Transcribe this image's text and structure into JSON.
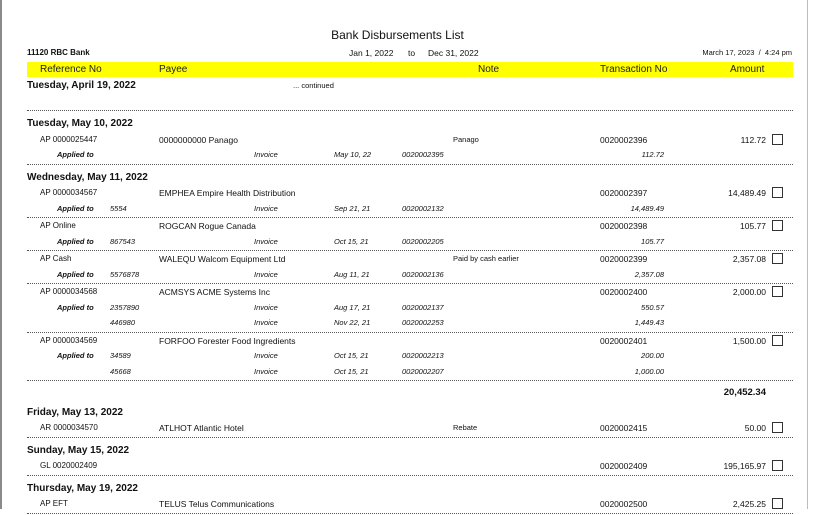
{
  "report": {
    "title": "Bank Disbursements List",
    "bank": "11120 RBC Bank",
    "date_from": "Jan 1, 2022",
    "to_label": "to",
    "date_to": "Dec 31, 2022",
    "printed": "March 17, 2023  /  4:24 pm"
  },
  "columns": {
    "reference": "Reference No",
    "payee": "Payee",
    "note": "Note",
    "transaction": "Transaction No",
    "amount": "Amount"
  },
  "continued_day": {
    "date": "Tuesday, April 19, 2022",
    "continued": "... continued"
  },
  "applied_label": "Applied to",
  "groups": [
    {
      "date": "Tuesday, May 10, 2022",
      "entries": [
        {
          "ref": "AP 0000025447",
          "payee": "0000000000 Panago",
          "note": "Panago",
          "trans": "0020002396",
          "amount": "112.72",
          "applied": [
            {
              "ref": "",
              "type": "Invoice",
              "date": "May 10, 22",
              "trans": "0020002395",
              "amount": "112.72"
            }
          ]
        }
      ]
    },
    {
      "date": "Wednesday, May 11, 2022",
      "total": "20,452.34",
      "entries": [
        {
          "ref": "AP 0000034567",
          "payee": "EMPHEA Empire Health Distribution",
          "note": "",
          "trans": "0020002397",
          "amount": "14,489.49",
          "applied": [
            {
              "ref": "5554",
              "type": "Invoice",
              "date": "Sep 21, 21",
              "trans": "0020002132",
              "amount": "14,489.49"
            }
          ]
        },
        {
          "ref": "AP Online",
          "payee": "ROGCAN Rogue Canada",
          "note": "",
          "trans": "0020002398",
          "amount": "105.77",
          "applied": [
            {
              "ref": "867543",
              "type": "Invoice",
              "date": "Oct 15, 21",
              "trans": "0020002205",
              "amount": "105.77"
            }
          ]
        },
        {
          "ref": "AP Cash",
          "payee": "WALEQU Walcom Equipment Ltd",
          "note": "Paid by cash earlier",
          "trans": "0020002399",
          "amount": "2,357.08",
          "applied": [
            {
              "ref": "5576878",
              "type": "Invoice",
              "date": "Aug 11, 21",
              "trans": "0020002136",
              "amount": "2,357.08"
            }
          ]
        },
        {
          "ref": "AP 0000034568",
          "payee": "ACMSYS ACME Systems Inc",
          "note": "",
          "trans": "0020002400",
          "amount": "2,000.00",
          "applied": [
            {
              "ref": "2357890",
              "type": "Invoice",
              "date": "Aug 17, 21",
              "trans": "0020002137",
              "amount": "550.57"
            },
            {
              "ref": "446980",
              "type": "Invoice",
              "date": "Nov 22, 21",
              "trans": "0020002253",
              "amount": "1,449.43"
            }
          ]
        },
        {
          "ref": "AP 0000034569",
          "payee": "FORFOO Forester Food Ingredients",
          "note": "",
          "trans": "0020002401",
          "amount": "1,500.00",
          "applied": [
            {
              "ref": "34589",
              "type": "Invoice",
              "date": "Oct 15, 21",
              "trans": "0020002213",
              "amount": "200.00"
            },
            {
              "ref": "45668",
              "type": "Invoice",
              "date": "Oct 15, 21",
              "trans": "0020002207",
              "amount": "1,000.00"
            }
          ]
        }
      ]
    },
    {
      "date": "Friday, May 13, 2022",
      "entries": [
        {
          "ref": "AR 0000034570",
          "payee": "ATLHOT Atlantic Hotel",
          "note": "Rebate",
          "trans": "0020002415",
          "amount": "50.00",
          "applied": []
        }
      ]
    },
    {
      "date": "Sunday, May 15, 2022",
      "entries": [
        {
          "ref": "GL 0020002409",
          "payee": "",
          "note": "",
          "trans": "0020002409",
          "amount": "195,165.97",
          "applied": []
        }
      ]
    },
    {
      "date": "Thursday, May 19, 2022",
      "entries": [
        {
          "ref": "AP EFT",
          "payee": "TELUS Telus Communications",
          "note": "",
          "trans": "0020002500",
          "amount": "2,425.25",
          "applied": []
        }
      ]
    }
  ]
}
